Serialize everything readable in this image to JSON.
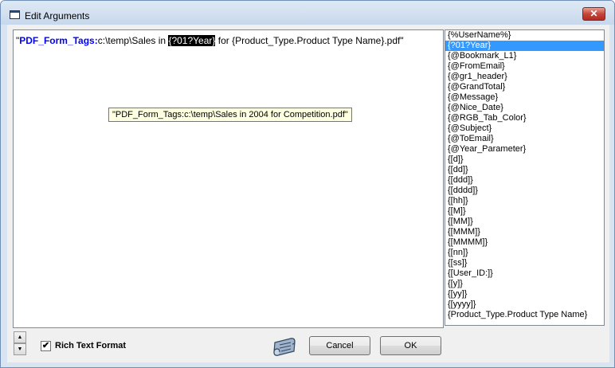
{
  "window": {
    "title": "Edit Arguments",
    "close_glyph": "✕"
  },
  "editor": {
    "prefix": "\"",
    "tag_name": "PDF_Form_Tags:",
    "path": "c:\\temp\\Sales in ",
    "selected_token": "{?01?Year}",
    "suffix": " for {Product_Type.Product Type Name}.pdf\""
  },
  "tooltip": {
    "text": "\"PDF_Form_Tags:c:\\temp\\Sales in 2004 for Competition.pdf\""
  },
  "variables": {
    "selected_index": 1,
    "items": [
      "{%UserName%}",
      "{?01?Year}",
      "{@Bookmark_L1}",
      "{@FromEmail}",
      "{@gr1_header}",
      "{@GrandTotal}",
      "{@Message}",
      "{@Nice_Date}",
      "{@RGB_Tab_Color}",
      "{@Subject}",
      "{@ToEmail}",
      "{@Year_Parameter}",
      "{[d]}",
      "{[dd]}",
      "{[ddd]}",
      "{[dddd]}",
      "{[hh]}",
      "{[M]}",
      "{[MM]}",
      "{[MMM]}",
      "{[MMMM]}",
      "{[nn]}",
      "{[ss]}",
      "{[User_ID:]}",
      "{[y]}",
      "{[yy]}",
      "{[yyyy]}",
      "{Product_Type.Product Type Name}"
    ]
  },
  "controls": {
    "spin_up_glyph": "▲",
    "spin_down_glyph": "▼",
    "rich_text_label": "Rich Text Format",
    "rich_text_checked": true,
    "check_glyph": "✔",
    "cancel_label": "Cancel",
    "ok_label": "OK",
    "scroll_icon": "scroll-icon"
  }
}
